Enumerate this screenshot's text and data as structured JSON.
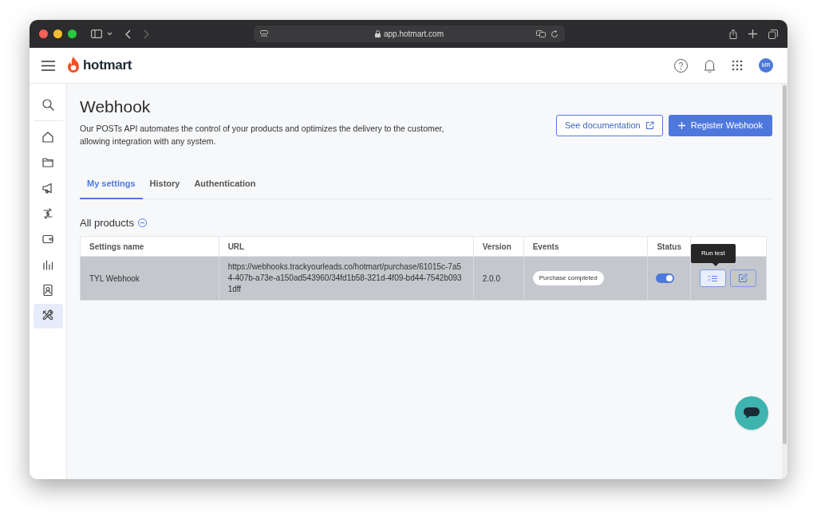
{
  "browser": {
    "url": "app.hotmart.com"
  },
  "header": {
    "logo": "hotmart",
    "avatar": "MR"
  },
  "sidebar": {
    "items": [
      {
        "kind": "search",
        "selected": false
      },
      {
        "kind": "home",
        "selected": false
      },
      {
        "kind": "folder",
        "selected": false
      },
      {
        "kind": "megaphone",
        "selected": false
      },
      {
        "kind": "money",
        "selected": false
      },
      {
        "kind": "wallet",
        "selected": false
      },
      {
        "kind": "chart",
        "selected": false
      },
      {
        "kind": "badge",
        "selected": false
      },
      {
        "kind": "tools",
        "selected": true
      }
    ]
  },
  "page": {
    "title": "Webhook",
    "description": "Our POSTs API automates the control of your products and optimizes the delivery to the customer, allowing integration with any system.",
    "buttons": [
      {
        "label": "See documentation",
        "kind": "secondary"
      },
      {
        "label": "Register Webhook",
        "kind": "primary"
      }
    ]
  },
  "tabs": [
    {
      "label": "My settings",
      "selected": true
    },
    {
      "label": "History",
      "selected": false
    },
    {
      "label": "Authentication",
      "selected": false
    }
  ],
  "section": {
    "title": "All products"
  },
  "table": {
    "columns": [
      "Settings name",
      "URL",
      "Version",
      "Events",
      "Status"
    ],
    "rows": [
      {
        "name": "TYL Webhook",
        "url": "https://webhooks.trackyourleads.co/hotmart/purchase/61015c-7a54-407b-a73e-a150ad543960/34fd1b58-321d-4f09-bd44-7542b0931dff",
        "version": "2.0.0",
        "event": "Purchase completed",
        "on": true,
        "tooltip": "Run test"
      }
    ]
  }
}
